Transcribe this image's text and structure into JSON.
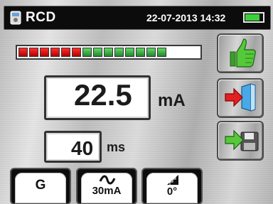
{
  "header": {
    "title": "RCD",
    "datetime": "22-07-2013 14:32",
    "battery_icon": "battery-icon",
    "title_icon": "instrument-icon"
  },
  "level_bar": {
    "red_segments": 6,
    "green_segments": 8,
    "total_segments": 18
  },
  "measurement": {
    "main_value": "22.5",
    "main_unit": "mA",
    "secondary_value": "40",
    "secondary_unit": "ms"
  },
  "side_buttons": [
    {
      "name": "ok",
      "icon": "thumbs-up-icon"
    },
    {
      "name": "exit",
      "icon": "exit-door-icon"
    },
    {
      "name": "save",
      "icon": "save-floppy-icon"
    }
  ],
  "bottom_buttons": [
    {
      "name": "mode",
      "label": "G"
    },
    {
      "name": "current",
      "label": "30mA",
      "icon": "ac-wave-icon"
    },
    {
      "name": "phase",
      "label": "0°",
      "icon": "phase-angle-icon"
    }
  ],
  "colors": {
    "ok_green": "#4cc235",
    "exit_red": "#e02020",
    "accent_blue": "#2a8fd8"
  }
}
